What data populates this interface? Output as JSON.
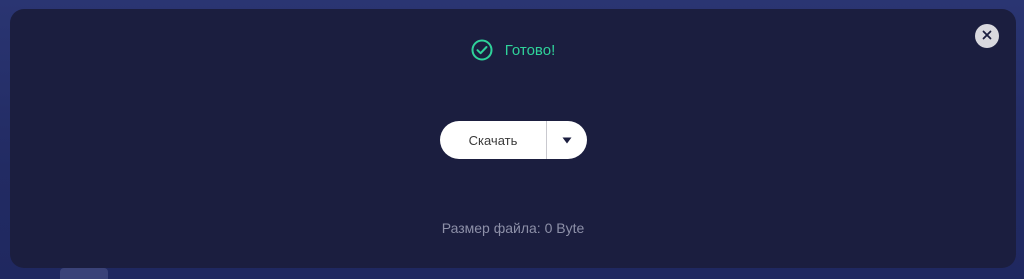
{
  "status": {
    "icon": "check-circle-icon",
    "text": "Готово!",
    "color": "#2fd29a"
  },
  "close": {
    "icon": "close-icon"
  },
  "download": {
    "label": "Скачать",
    "dropdown_icon": "caret-down-icon"
  },
  "file_size": {
    "text": "Размер файла: 0 Byte"
  },
  "colors": {
    "panel_bg": "#1b1e3f",
    "page_bg": "#232c64",
    "button_bg": "#ffffff"
  }
}
